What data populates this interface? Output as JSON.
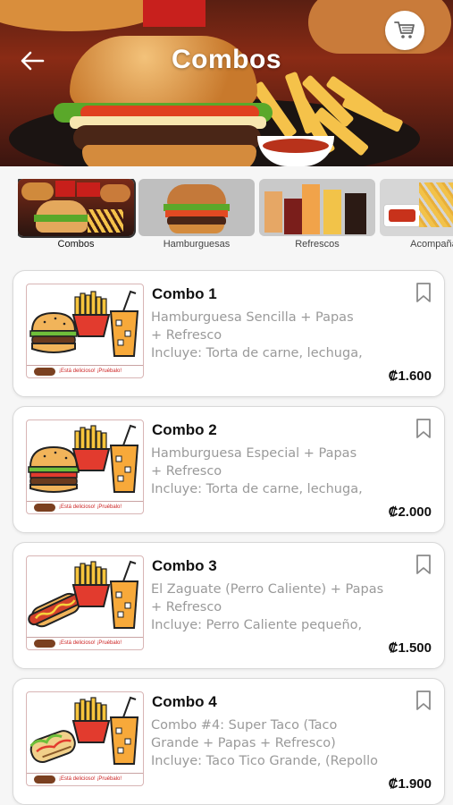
{
  "header": {
    "title": "Combos",
    "back_icon": "arrow-left-icon",
    "cart_icon": "shopping-cart-icon"
  },
  "categories": [
    {
      "label": "Combos",
      "active": true
    },
    {
      "label": "Hamburguesas",
      "active": false
    },
    {
      "label": "Refrescos",
      "active": false
    },
    {
      "label": "Acompañam",
      "active": false
    }
  ],
  "products": [
    {
      "name": "Combo 1",
      "desc_line1": "Hamburguesa Sencilla + Papas",
      "desc_line2": "+ Refresco",
      "desc_line3": "Incluye: Torta de carne, lechuga,",
      "price": "₡1.600",
      "tagline": "¡Está delicioso! ¡Pruébalo!",
      "main_item": "burger"
    },
    {
      "name": "Combo 2",
      "desc_line1": "Hamburguesa Especial + Papas",
      "desc_line2": "+ Refresco",
      "desc_line3": "Incluye: Torta de carne, lechuga,",
      "price": "₡2.000",
      "tagline": "¡Está delicioso! ¡Pruébalo!",
      "main_item": "burger"
    },
    {
      "name": "Combo 3",
      "desc_line1": "El Zaguate (Perro Caliente) + Papas",
      "desc_line2": "+ Refresco",
      "desc_line3": "Incluye: Perro Caliente pequeño,",
      "price": "₡1.500",
      "tagline": "¡Está delicioso! ¡Pruébalo!",
      "main_item": "hotdog"
    },
    {
      "name": "Combo 4",
      "desc_line1": "Combo #4: Super Taco (Taco",
      "desc_line2": "Grande + Papas + Refresco)",
      "desc_line3": "Incluye: Taco Tico Grande, (Repollo",
      "price": "₡1.900",
      "tagline": "¡Está delicioso! ¡Pruébalo!",
      "main_item": "taco"
    }
  ],
  "colors": {
    "accent_red": "#d32020",
    "price_text": "#111111",
    "desc_text": "#9a9a9a"
  }
}
